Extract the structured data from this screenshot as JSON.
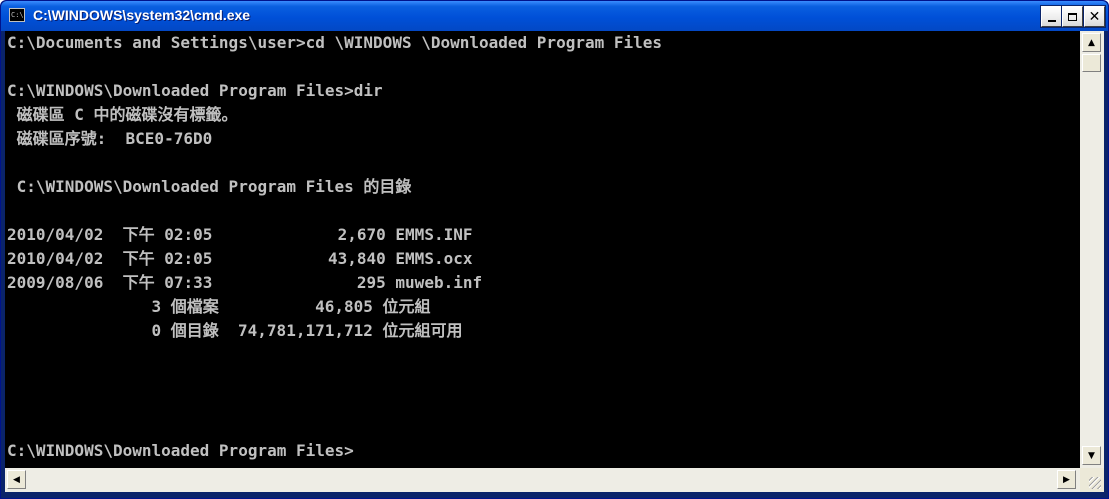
{
  "window": {
    "title": "C:\\WINDOWS\\system32\\cmd.exe",
    "icon": "console-icon",
    "icon_text": "C:\\"
  },
  "console": {
    "lines": [
      "C:\\Documents and Settings\\user>cd \\WINDOWS \\Downloaded Program Files",
      "",
      "C:\\WINDOWS\\Downloaded Program Files>dir",
      " 磁碟區 C 中的磁碟沒有標籤。",
      " 磁碟區序號:  BCE0-76D0",
      "",
      " C:\\WINDOWS\\Downloaded Program Files 的目錄",
      "",
      "2010/04/02  下午 02:05             2,670 EMMS.INF",
      "2010/04/02  下午 02:05            43,840 EMMS.ocx",
      "2009/08/06  下午 07:33               295 muweb.inf",
      "               3 個檔案          46,805 位元組",
      "               0 個目錄  74,781,171,712 位元組可用",
      "",
      "C:\\WINDOWS\\Downloaded Program Files>"
    ]
  },
  "colors": {
    "titlebar": "#0050d8",
    "console_bg": "#000000",
    "console_fg": "#c0c0c0"
  }
}
